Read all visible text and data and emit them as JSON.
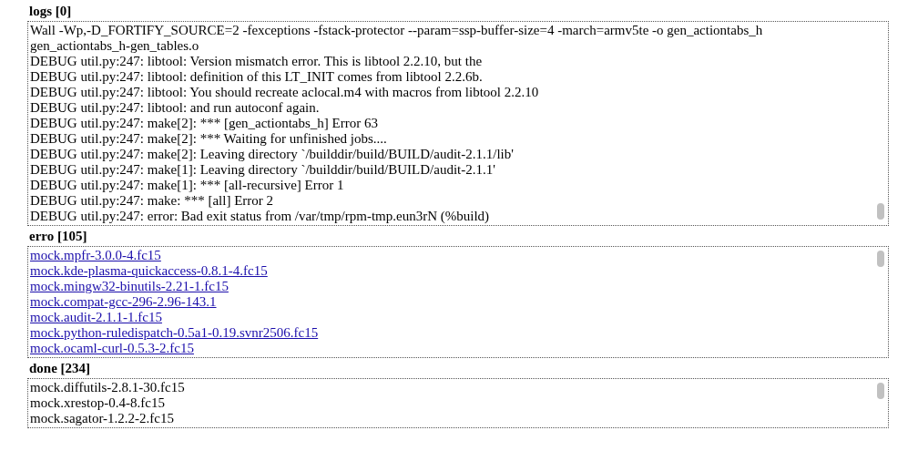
{
  "sections": [
    {
      "title": "logs [0]",
      "kind": "text",
      "lines": [
        "Wall -Wp,-D_FORTIFY_SOURCE=2 -fexceptions -fstack-protector --param=ssp-buffer-size=4 -march=armv5te -o gen_actiontabs_h",
        "gen_actiontabs_h-gen_tables.o",
        "DEBUG util.py:247: libtool: Version mismatch error. This is libtool 2.2.10, but the",
        "DEBUG util.py:247: libtool: definition of this LT_INIT comes from libtool 2.2.6b.",
        "DEBUG util.py:247: libtool: You should recreate aclocal.m4 with macros from libtool 2.2.10",
        "DEBUG util.py:247: libtool: and run autoconf again.",
        "DEBUG util.py:247: make[2]: *** [gen_actiontabs_h] Error 63",
        "DEBUG util.py:247: make[2]: *** Waiting for unfinished jobs....",
        "DEBUG util.py:247: make[2]: Leaving directory `/builddir/build/BUILD/audit-2.1.1/lib'",
        "DEBUG util.py:247: make[1]: Leaving directory `/builddir/build/BUILD/audit-2.1.1'",
        "DEBUG util.py:247: make[1]: *** [all-recursive] Error 1",
        "DEBUG util.py:247: make: *** [all] Error 2",
        "DEBUG util.py:247: error: Bad exit status from /var/tmp/rpm-tmp.eun3rN (%build)"
      ]
    },
    {
      "title": "erro [105]",
      "kind": "links",
      "lines": [
        "mock.mpfr-3.0.0-4.fc15",
        "mock.kde-plasma-quickaccess-0.8.1-4.fc15",
        "mock.mingw32-binutils-2.21-1.fc15",
        "mock.compat-gcc-296-2.96-143.1",
        "mock.audit-2.1.1-1.fc15",
        "mock.python-ruledispatch-0.5a1-0.19.svnr2506.fc15",
        "mock.ocaml-curl-0.5.3-2.fc15"
      ]
    },
    {
      "title": "done [234]",
      "kind": "text",
      "lines": [
        "mock.diffutils-2.8.1-30.fc15",
        "mock.xrestop-0.4-8.fc15",
        "mock.sagator-1.2.2-2.fc15"
      ]
    }
  ]
}
